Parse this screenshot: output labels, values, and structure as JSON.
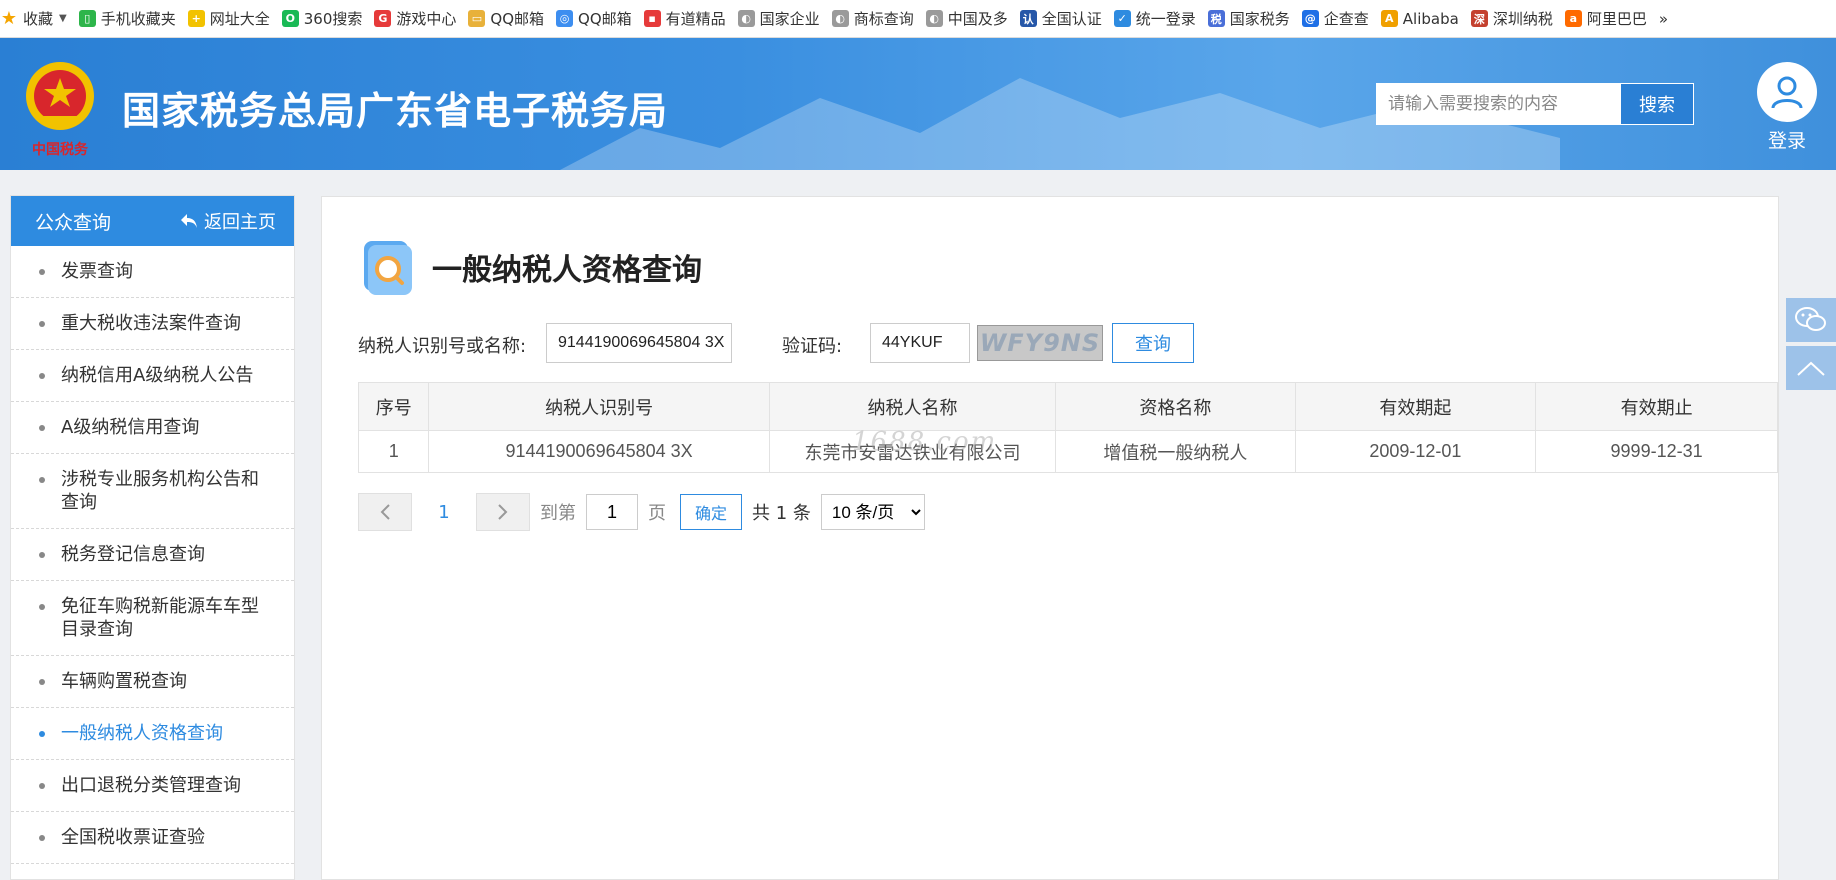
{
  "bookmarks": [
    {
      "label": "收藏",
      "color": "#f5a500",
      "glyph": "★",
      "icon": "star-icon"
    },
    {
      "label": "手机收藏夹",
      "color": "#2db54a",
      "glyph": "▯",
      "icon": "phone-icon"
    },
    {
      "label": "网址大全",
      "color": "#f2c200",
      "glyph": "+",
      "icon": "nav-icon"
    },
    {
      "label": "360搜索",
      "color": "#19b955",
      "glyph": "O",
      "icon": "360-search-icon"
    },
    {
      "label": "游戏中心",
      "color": "#e63a3a",
      "glyph": "G",
      "icon": "game-icon"
    },
    {
      "label": "QQ邮箱",
      "color": "#e8b13a",
      "glyph": "▭",
      "icon": "folder-icon"
    },
    {
      "label": "QQ邮箱",
      "color": "#3d8ef0",
      "glyph": "◎",
      "icon": "qq-mail-icon"
    },
    {
      "label": "有道精品",
      "color": "#e63a3a",
      "glyph": "▪",
      "icon": "youdao-icon"
    },
    {
      "label": "国家企业",
      "color": "#9a9a9a",
      "glyph": "◐",
      "icon": "globe-icon"
    },
    {
      "label": "商标查询",
      "color": "#9a9a9a",
      "glyph": "◐",
      "icon": "globe-icon"
    },
    {
      "label": "中国及多",
      "color": "#9a9a9a",
      "glyph": "◐",
      "icon": "globe-icon"
    },
    {
      "label": "全国认证",
      "color": "#2657a8",
      "glyph": "认",
      "icon": "cert-icon"
    },
    {
      "label": "统一登录",
      "color": "#2e8be0",
      "glyph": "✓",
      "icon": "shield-icon"
    },
    {
      "label": "国家税务",
      "color": "#4a6fd8",
      "glyph": "税",
      "icon": "tax-icon"
    },
    {
      "label": "企查查",
      "color": "#1e6fe6",
      "glyph": "@",
      "icon": "qichacha-icon"
    },
    {
      "label": "Alibaba",
      "color": "#f0a000",
      "glyph": "A",
      "icon": "alibaba-icon"
    },
    {
      "label": "深圳纳税",
      "color": "#c4412f",
      "glyph": "深",
      "icon": "shenzhen-tax-icon"
    },
    {
      "label": "阿里巴巴",
      "color": "#ff6a00",
      "glyph": "a",
      "icon": "1688-icon"
    }
  ],
  "bookmarks_more": "»",
  "header": {
    "title": "国家税务总局广东省电子税务局",
    "search_placeholder": "请输入需要搜索的内容",
    "search_button": "搜索",
    "login_label": "登录"
  },
  "sidebar": {
    "title": "公众查询",
    "back_label": "返回主页",
    "items": [
      {
        "label": "发票查询"
      },
      {
        "label": "重大税收违法案件查询"
      },
      {
        "label": "纳税信用A级纳税人公告"
      },
      {
        "label": "A级纳税信用查询"
      },
      {
        "label": "涉税专业服务机构公告和查询"
      },
      {
        "label": "税务登记信息查询"
      },
      {
        "label": "免征车购税新能源车车型目录查询"
      },
      {
        "label": "车辆购置税查询"
      },
      {
        "label": "一般纳税人资格查询"
      },
      {
        "label": "出口退税分类管理查询"
      },
      {
        "label": "全国税收票证查验"
      }
    ],
    "active_index": 8
  },
  "main": {
    "title": "一般纳税人资格查询",
    "form": {
      "taxpayer_label": "纳税人识别号或名称:",
      "taxpayer_value": "9144190069645804 3X",
      "captcha_label": "验证码:",
      "captcha_value": "44YKUF",
      "captcha_image_text": "WFY9NS",
      "query_button": "查询"
    },
    "table": {
      "headers": [
        "序号",
        "纳税人识别号",
        "纳税人名称",
        "资格名称",
        "有效期起",
        "有效期止"
      ],
      "rows": [
        [
          "1",
          "9144190069645804 3X",
          "东莞市安雷达铁业有限公司",
          "增值税一般纳税人",
          "2009-12-01",
          "9999-12-31"
        ]
      ]
    },
    "watermark": "1688.com",
    "pager": {
      "prev": "‹",
      "current": "1",
      "next": "›",
      "goto_label": "到第",
      "goto_value": "1",
      "page_unit": "页",
      "confirm": "确定",
      "total": "共 1 条",
      "page_size": "10 条/页"
    }
  }
}
